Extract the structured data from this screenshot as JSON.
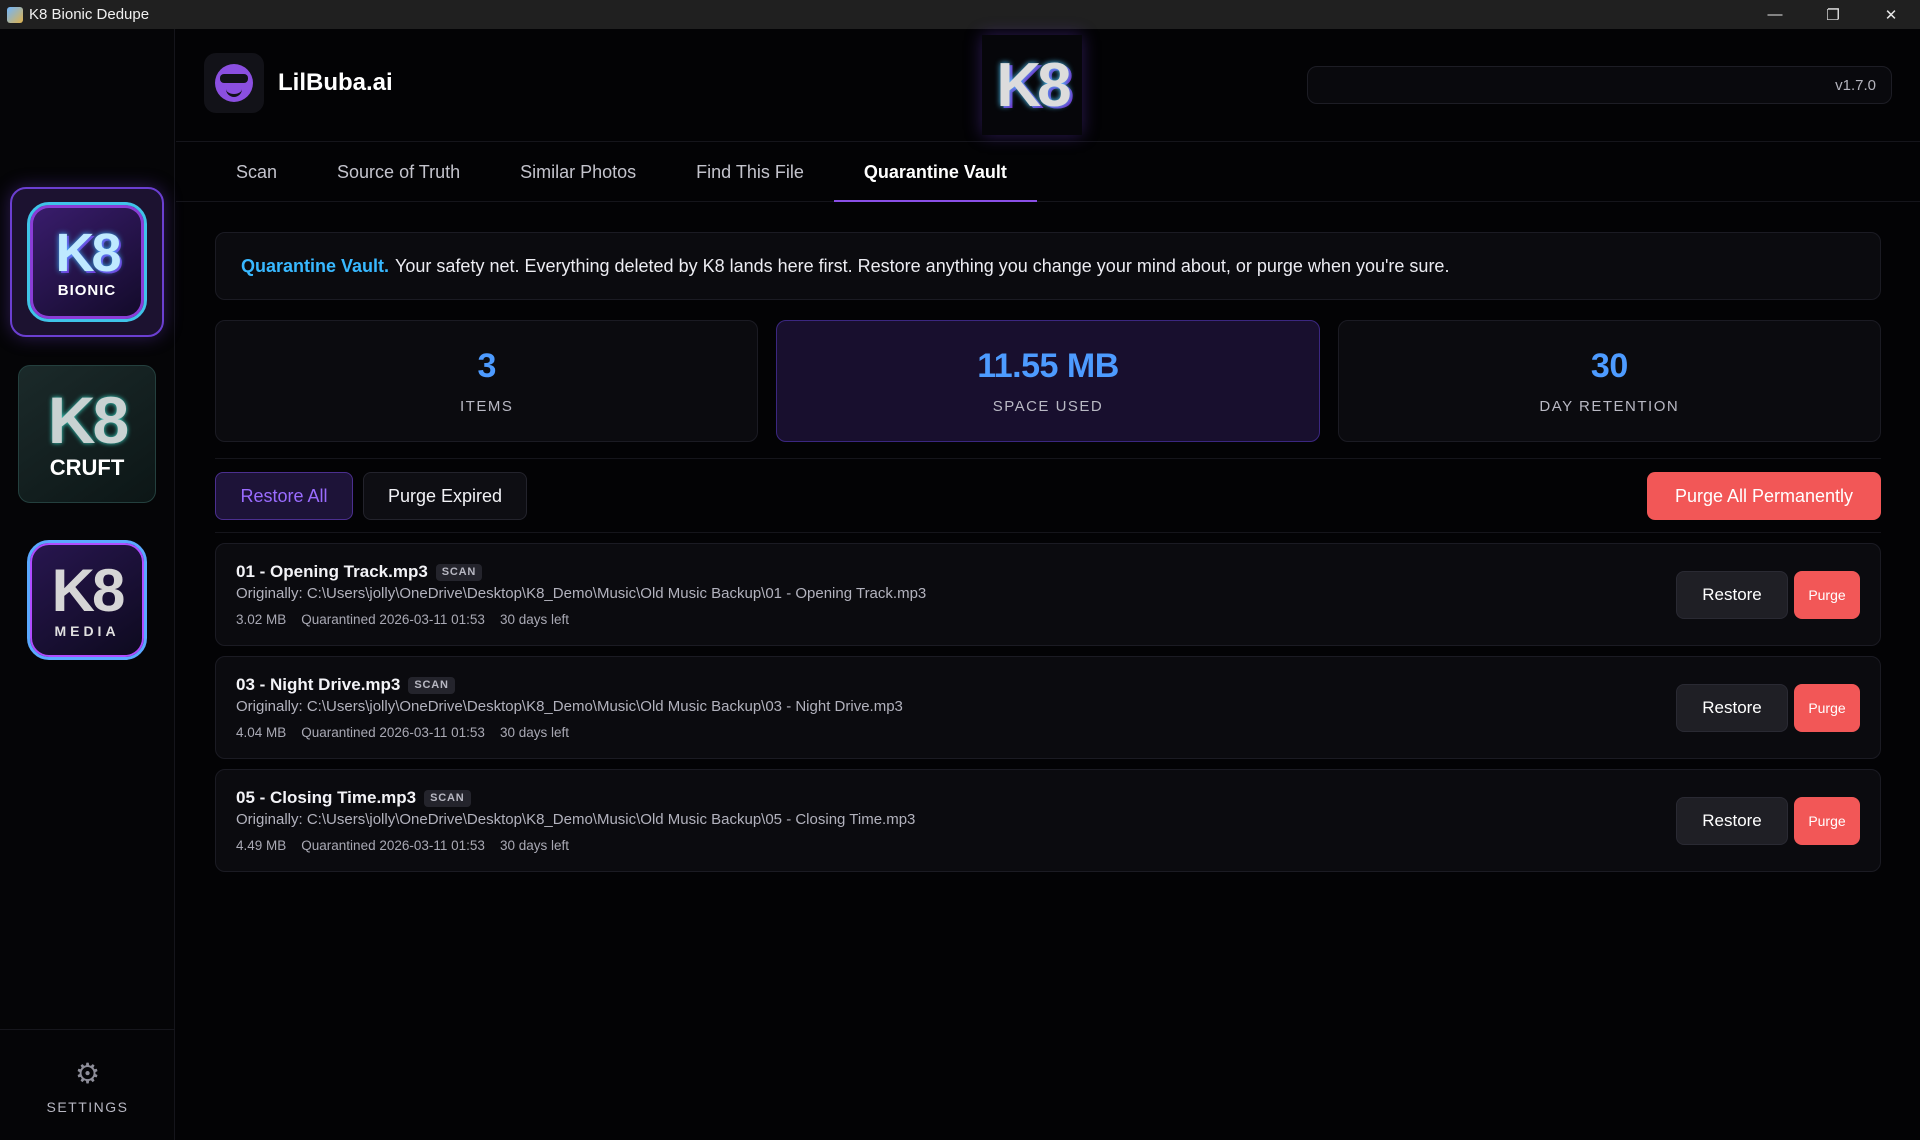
{
  "window": {
    "title": "K8 Bionic Dedupe",
    "controls": {
      "minimize": "—",
      "maximize": "❐",
      "close": "✕"
    }
  },
  "sidebar": {
    "apps": [
      {
        "id": "bionic",
        "logo_text": "K8",
        "sub_label": "BIONIC",
        "active": true,
        "icon": "k8-bionic-logo"
      },
      {
        "id": "cruft",
        "logo_text": "K8",
        "sub_label": "CRUFT",
        "active": false,
        "icon": "k8-cruft-logo"
      },
      {
        "id": "media",
        "logo_text": "K8",
        "sub_label": "MEDIA",
        "active": false,
        "icon": "k8-media-logo"
      }
    ],
    "settings_label": "SETTINGS",
    "settings_icon": "gear-icon"
  },
  "header": {
    "brand_name": "LilBuba.ai",
    "brand_icon": "lilbuba-face-icon",
    "center_logo_text": "K8",
    "version": "v1.7.0"
  },
  "tabs": [
    {
      "label": "Scan",
      "active": false
    },
    {
      "label": "Source of Truth",
      "active": false
    },
    {
      "label": "Similar Photos",
      "active": false
    },
    {
      "label": "Find This File",
      "active": false
    },
    {
      "label": "Quarantine Vault",
      "active": true
    }
  ],
  "banner": {
    "title": "Quarantine Vault.",
    "text": "Your safety net. Everything deleted by K8 lands here first. Restore anything you change your mind about, or purge when you're sure."
  },
  "stats": [
    {
      "value": "3",
      "label": "ITEMS"
    },
    {
      "value": "11.55 MB",
      "label": "SPACE USED"
    },
    {
      "value": "30",
      "label": "DAY RETENTION"
    }
  ],
  "actions": {
    "restore_all": "Restore All",
    "purge_expired": "Purge Expired",
    "purge_all": "Purge All Permanently"
  },
  "items": [
    {
      "name": "01 - Opening Track.mp3",
      "badge": "SCAN",
      "path": "Originally: C:\\Users\\jolly\\OneDrive\\Desktop\\K8_Demo\\Music\\Old Music Backup\\01 - Opening Track.mp3",
      "size": "3.02 MB",
      "quarantined": "Quarantined 2026-03-11 01:53",
      "remaining": "30 days left",
      "restore_label": "Restore",
      "purge_label": "Purge"
    },
    {
      "name": "03 - Night Drive.mp3",
      "badge": "SCAN",
      "path": "Originally: C:\\Users\\jolly\\OneDrive\\Desktop\\K8_Demo\\Music\\Old Music Backup\\03 - Night Drive.mp3",
      "size": "4.04 MB",
      "quarantined": "Quarantined 2026-03-11 01:53",
      "remaining": "30 days left",
      "restore_label": "Restore",
      "purge_label": "Purge"
    },
    {
      "name": "05 - Closing Time.mp3",
      "badge": "SCAN",
      "path": "Originally: C:\\Users\\jolly\\OneDrive\\Desktop\\K8_Demo\\Music\\Old Music Backup\\05 - Closing Time.mp3",
      "size": "4.49 MB",
      "quarantined": "Quarantined 2026-03-11 01:53",
      "remaining": "30 days left",
      "restore_label": "Restore",
      "purge_label": "Purge"
    }
  ],
  "colors": {
    "accent_purple": "#8a4fe6",
    "accent_blue": "#4d9bff",
    "accent_cyan": "#38b8ff",
    "danger_red": "#f25757",
    "background": "#030305"
  }
}
